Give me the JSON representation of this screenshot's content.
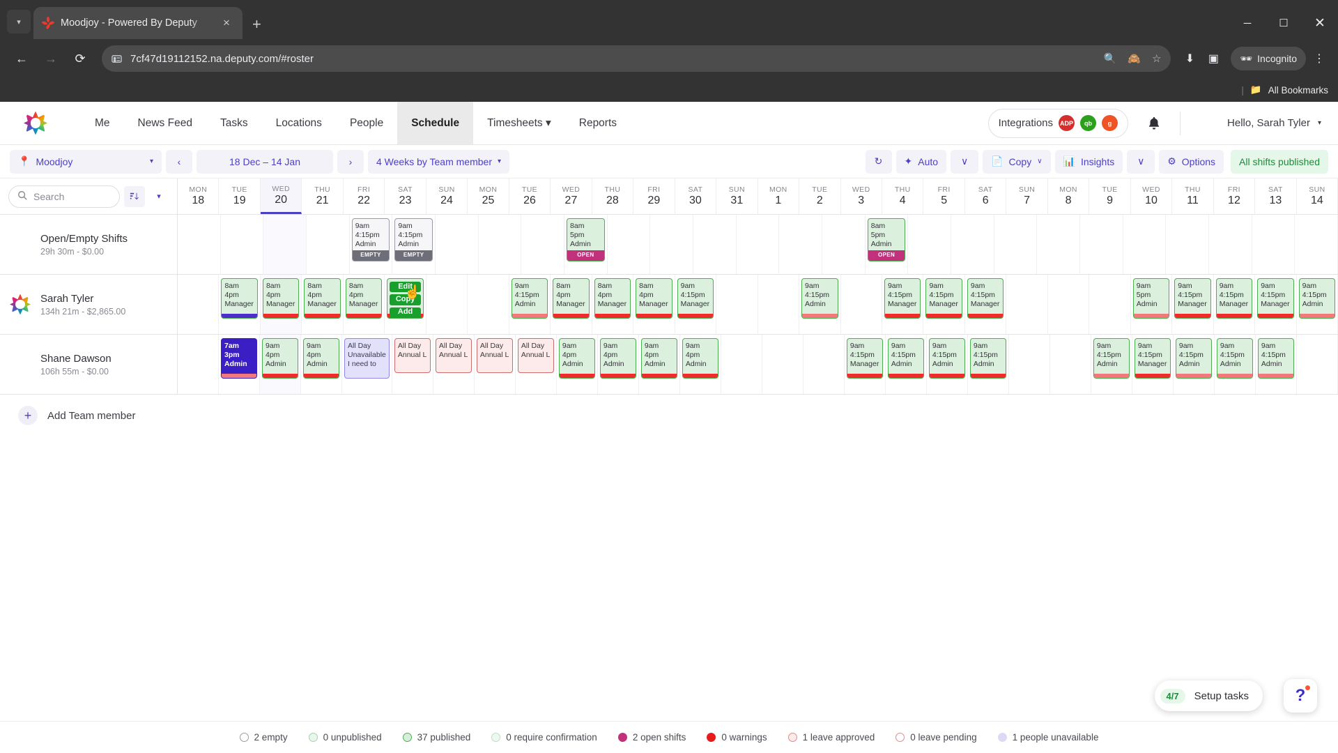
{
  "browser": {
    "tab_title": "Moodjoy - Powered By Deputy",
    "url": "7cf47d19112152.na.deputy.com/#roster",
    "new_tab_label": "+",
    "close_tab_label": "×",
    "incognito_label": "Incognito",
    "bookmarks_label": "All Bookmarks",
    "minimize": "─",
    "maximize": "☐",
    "close": "✕"
  },
  "header": {
    "nav": [
      {
        "label": "Me",
        "active": false
      },
      {
        "label": "News Feed",
        "active": false
      },
      {
        "label": "Tasks",
        "active": false
      },
      {
        "label": "Locations",
        "active": false
      },
      {
        "label": "People",
        "active": false
      },
      {
        "label": "Schedule",
        "active": true
      },
      {
        "label": "Timesheets ▾",
        "active": false
      },
      {
        "label": "Reports",
        "active": false
      }
    ],
    "integrations_label": "Integrations",
    "integration_badges": [
      {
        "text": "ADP",
        "color": "#d32f2f"
      },
      {
        "text": "qb",
        "color": "#2ca01c"
      },
      {
        "text": "g",
        "color": "#f05323"
      }
    ],
    "user_greeting": "Hello, Sarah Tyler",
    "user_caret": "▾"
  },
  "controls": {
    "location": "Moodjoy",
    "prev": "‹",
    "date_range": "18 Dec – 14 Jan",
    "next": "›",
    "view_mode": "4 Weeks by Team member",
    "refresh": "↻",
    "auto": "Auto",
    "auto_caret": "∨",
    "copy": "Copy",
    "copy_caret": "∨",
    "insights": "Insights",
    "insights_caret": "∨",
    "options": "Options",
    "publish_status": "All shifts published"
  },
  "schedule": {
    "search_placeholder": "Search",
    "days": [
      {
        "dow": "MON",
        "num": "18",
        "today": false
      },
      {
        "dow": "TUE",
        "num": "19",
        "today": false
      },
      {
        "dow": "WED",
        "num": "20",
        "today": true
      },
      {
        "dow": "THU",
        "num": "21",
        "today": false
      },
      {
        "dow": "FRI",
        "num": "22",
        "today": false
      },
      {
        "dow": "SAT",
        "num": "23",
        "today": false
      },
      {
        "dow": "SUN",
        "num": "24",
        "today": false
      },
      {
        "dow": "MON",
        "num": "25",
        "today": false
      },
      {
        "dow": "TUE",
        "num": "26",
        "today": false
      },
      {
        "dow": "WED",
        "num": "27",
        "today": false
      },
      {
        "dow": "THU",
        "num": "28",
        "today": false
      },
      {
        "dow": "FRI",
        "num": "29",
        "today": false
      },
      {
        "dow": "SAT",
        "num": "30",
        "today": false
      },
      {
        "dow": "SUN",
        "num": "31",
        "today": false
      },
      {
        "dow": "MON",
        "num": "1",
        "today": false
      },
      {
        "dow": "TUE",
        "num": "2",
        "today": false
      },
      {
        "dow": "WED",
        "num": "3",
        "today": false
      },
      {
        "dow": "THU",
        "num": "4",
        "today": false
      },
      {
        "dow": "FRI",
        "num": "5",
        "today": false
      },
      {
        "dow": "SAT",
        "num": "6",
        "today": false
      },
      {
        "dow": "SUN",
        "num": "7",
        "today": false
      },
      {
        "dow": "MON",
        "num": "8",
        "today": false
      },
      {
        "dow": "TUE",
        "num": "9",
        "today": false
      },
      {
        "dow": "WED",
        "num": "10",
        "today": false
      },
      {
        "dow": "THU",
        "num": "11",
        "today": false
      },
      {
        "dow": "FRI",
        "num": "12",
        "today": false
      },
      {
        "dow": "SAT",
        "num": "13",
        "today": false
      },
      {
        "dow": "SUN",
        "num": "14",
        "today": false
      }
    ],
    "rows": [
      {
        "name": "Open/Empty Shifts",
        "sub": "29h 30m - $0.00",
        "avatar": "person-icon",
        "cells": [
          null,
          null,
          null,
          null,
          {
            "style": "shift-gray",
            "lines": [
              "9am",
              "4:15pm",
              "Admin"
            ],
            "badge": "EMPTY",
            "badge_style": "badge-empty"
          },
          {
            "style": "shift-gray",
            "lines": [
              "9am",
              "4:15pm",
              "Admin"
            ],
            "badge": "EMPTY",
            "badge_style": "badge-empty"
          },
          null,
          null,
          null,
          {
            "style": "shift-green",
            "lines": [
              "8am",
              "5pm",
              "Admin"
            ],
            "badge": "OPEN",
            "badge_style": "badge-open"
          },
          null,
          null,
          null,
          null,
          null,
          null,
          {
            "style": "shift-green",
            "lines": [
              "8am",
              "5pm",
              "Admin"
            ],
            "badge": "OPEN",
            "badge_style": "badge-open"
          },
          null,
          null,
          null,
          null,
          null,
          null,
          null,
          null,
          null,
          null
        ]
      },
      {
        "name": "Sarah Tyler",
        "sub": "134h 21m - $2,865.00",
        "avatar": "rainbow-star-avatar",
        "cells": [
          null,
          {
            "style": "shift-green",
            "lines": [
              "8am",
              "4pm",
              "Manager"
            ],
            "bar": "bar-purple"
          },
          {
            "style": "shift-green",
            "lines": [
              "8am",
              "4pm",
              "Manager"
            ],
            "bar": "bar-red"
          },
          {
            "style": "shift-green",
            "lines": [
              "8am",
              "4pm",
              "Manager"
            ],
            "bar": "bar-red"
          },
          {
            "style": "shift-green",
            "lines": [
              "8am",
              "4pm",
              "Manager"
            ],
            "bar": "bar-red"
          },
          {
            "style": "shift-green",
            "lines": [
              "",
              "",
              ""
            ],
            "bar": "bar-red",
            "menu": true
          },
          null,
          null,
          {
            "style": "shift-green",
            "lines": [
              "9am",
              "4:15pm",
              "Admin"
            ],
            "bar": "bar-pink"
          },
          {
            "style": "shift-green",
            "lines": [
              "8am",
              "4pm",
              "Manager"
            ],
            "bar": "bar-red"
          },
          {
            "style": "shift-green",
            "lines": [
              "8am",
              "4pm",
              "Manager"
            ],
            "bar": "bar-red"
          },
          {
            "style": "shift-green",
            "lines": [
              "8am",
              "4pm",
              "Manager"
            ],
            "bar": "bar-red"
          },
          {
            "style": "shift-green",
            "lines": [
              "9am",
              "4:15pm",
              "Manager"
            ],
            "bar": "bar-red"
          },
          null,
          null,
          {
            "style": "shift-green",
            "lines": [
              "9am",
              "4:15pm",
              "Admin"
            ],
            "bar": "bar-pink"
          },
          null,
          {
            "style": "shift-green",
            "lines": [
              "9am",
              "4:15pm",
              "Manager"
            ],
            "bar": "bar-red"
          },
          {
            "style": "shift-green",
            "lines": [
              "9am",
              "4:15pm",
              "Manager"
            ],
            "bar": "bar-red"
          },
          {
            "style": "shift-green",
            "lines": [
              "9am",
              "4:15pm",
              "Manager"
            ],
            "bar": "bar-red"
          },
          null,
          null,
          null,
          {
            "style": "shift-green",
            "lines": [
              "9am",
              "5pm",
              "Admin"
            ],
            "bar": "bar-pink"
          },
          {
            "style": "shift-green",
            "lines": [
              "9am",
              "4:15pm",
              "Manager"
            ],
            "bar": "bar-red"
          },
          {
            "style": "shift-green",
            "lines": [
              "9am",
              "4:15pm",
              "Manager"
            ],
            "bar": "bar-red"
          },
          {
            "style": "shift-green",
            "lines": [
              "9am",
              "4:15pm",
              "Manager"
            ],
            "bar": "bar-red"
          },
          {
            "style": "shift-green",
            "lines": [
              "9am",
              "4:15pm",
              "Admin"
            ],
            "bar": "bar-pink"
          }
        ]
      },
      {
        "name": "Shane Dawson",
        "sub": "106h 55m - $0.00",
        "avatar": "circle-swirl-avatar",
        "cells": [
          null,
          {
            "style": "shift-blue",
            "lines": [
              "7am",
              "3pm",
              "Admin"
            ],
            "bar": "bar-pink"
          },
          {
            "style": "shift-green",
            "lines": [
              "9am",
              "4pm",
              "Admin"
            ],
            "bar": "bar-red"
          },
          {
            "style": "shift-green",
            "lines": [
              "9am",
              "4pm",
              "Admin"
            ],
            "bar": "bar-red"
          },
          {
            "style": "shift-lav",
            "lines": [
              "All Day",
              "Unavailable",
              "I need to"
            ]
          },
          {
            "style": "shift-pink",
            "lines": [
              "All Day",
              "Annual L"
            ]
          },
          {
            "style": "shift-pink",
            "lines": [
              "All Day",
              "Annual L"
            ]
          },
          {
            "style": "shift-pink",
            "lines": [
              "All Day",
              "Annual L"
            ]
          },
          {
            "style": "shift-pink",
            "lines": [
              "All Day",
              "Annual L"
            ]
          },
          {
            "style": "shift-green",
            "lines": [
              "9am",
              "4pm",
              "Admin"
            ],
            "bar": "bar-red"
          },
          {
            "style": "shift-green",
            "lines": [
              "9am",
              "4pm",
              "Admin"
            ],
            "bar": "bar-red"
          },
          {
            "style": "shift-green",
            "lines": [
              "9am",
              "4pm",
              "Admin"
            ],
            "bar": "bar-red"
          },
          {
            "style": "shift-green",
            "lines": [
              "9am",
              "4pm",
              "Admin"
            ],
            "bar": "bar-red"
          },
          null,
          null,
          null,
          {
            "style": "shift-green",
            "lines": [
              "9am",
              "4:15pm",
              "Manager"
            ],
            "bar": "bar-red"
          },
          {
            "style": "shift-green",
            "lines": [
              "9am",
              "4:15pm",
              "Admin"
            ],
            "bar": "bar-red"
          },
          {
            "style": "shift-green",
            "lines": [
              "9am",
              "4:15pm",
              "Admin"
            ],
            "bar": "bar-red"
          },
          {
            "style": "shift-green",
            "lines": [
              "9am",
              "4:15pm",
              "Admin"
            ],
            "bar": "bar-red"
          },
          null,
          null,
          {
            "style": "shift-green",
            "lines": [
              "9am",
              "4:15pm",
              "Admin"
            ],
            "bar": "bar-pink"
          },
          {
            "style": "shift-green",
            "lines": [
              "9am",
              "4:15pm",
              "Manager"
            ],
            "bar": "bar-red"
          },
          {
            "style": "shift-green",
            "lines": [
              "9am",
              "4:15pm",
              "Admin"
            ],
            "bar": "bar-pink"
          },
          {
            "style": "shift-green",
            "lines": [
              "9am",
              "4:15pm",
              "Admin"
            ],
            "bar": "bar-pink"
          },
          {
            "style": "shift-green",
            "lines": [
              "9am",
              "4:15pm",
              "Admin"
            ],
            "bar": "bar-pink"
          },
          null
        ]
      }
    ],
    "context_menu": [
      "Edit",
      "Copy",
      "Add"
    ],
    "add_member_label": "Add Team member",
    "add_member_icon": "+"
  },
  "footer": {
    "legend": [
      {
        "label": "2 empty",
        "color": "#ffffff",
        "border": "#9a9aa6"
      },
      {
        "label": "0 unpublished",
        "color": "#e8f6ec",
        "border": "#9fd4ae"
      },
      {
        "label": "37 published",
        "color": "#d4f0da",
        "border": "#4caf50"
      },
      {
        "label": "0 require confirmation",
        "color": "#edf8ef",
        "border": "#bcdfc4"
      },
      {
        "label": "2 open shifts",
        "color": "#c2317b",
        "border": "#c2317b"
      },
      {
        "label": "0 warnings",
        "color": "#e81b1b",
        "border": "#e81b1b"
      },
      {
        "label": "1 leave approved",
        "color": "#fdeaea",
        "border": "#e08a8a"
      },
      {
        "label": "0 leave pending",
        "color": "#ffffff",
        "border": "#e08a8a"
      },
      {
        "label": "1 people unavailable",
        "color": "#dcd9f7",
        "border": "#dcd9f7"
      }
    ]
  },
  "widgets": {
    "setup_count": "4/7",
    "setup_label": "Setup tasks",
    "help_label": "?"
  }
}
